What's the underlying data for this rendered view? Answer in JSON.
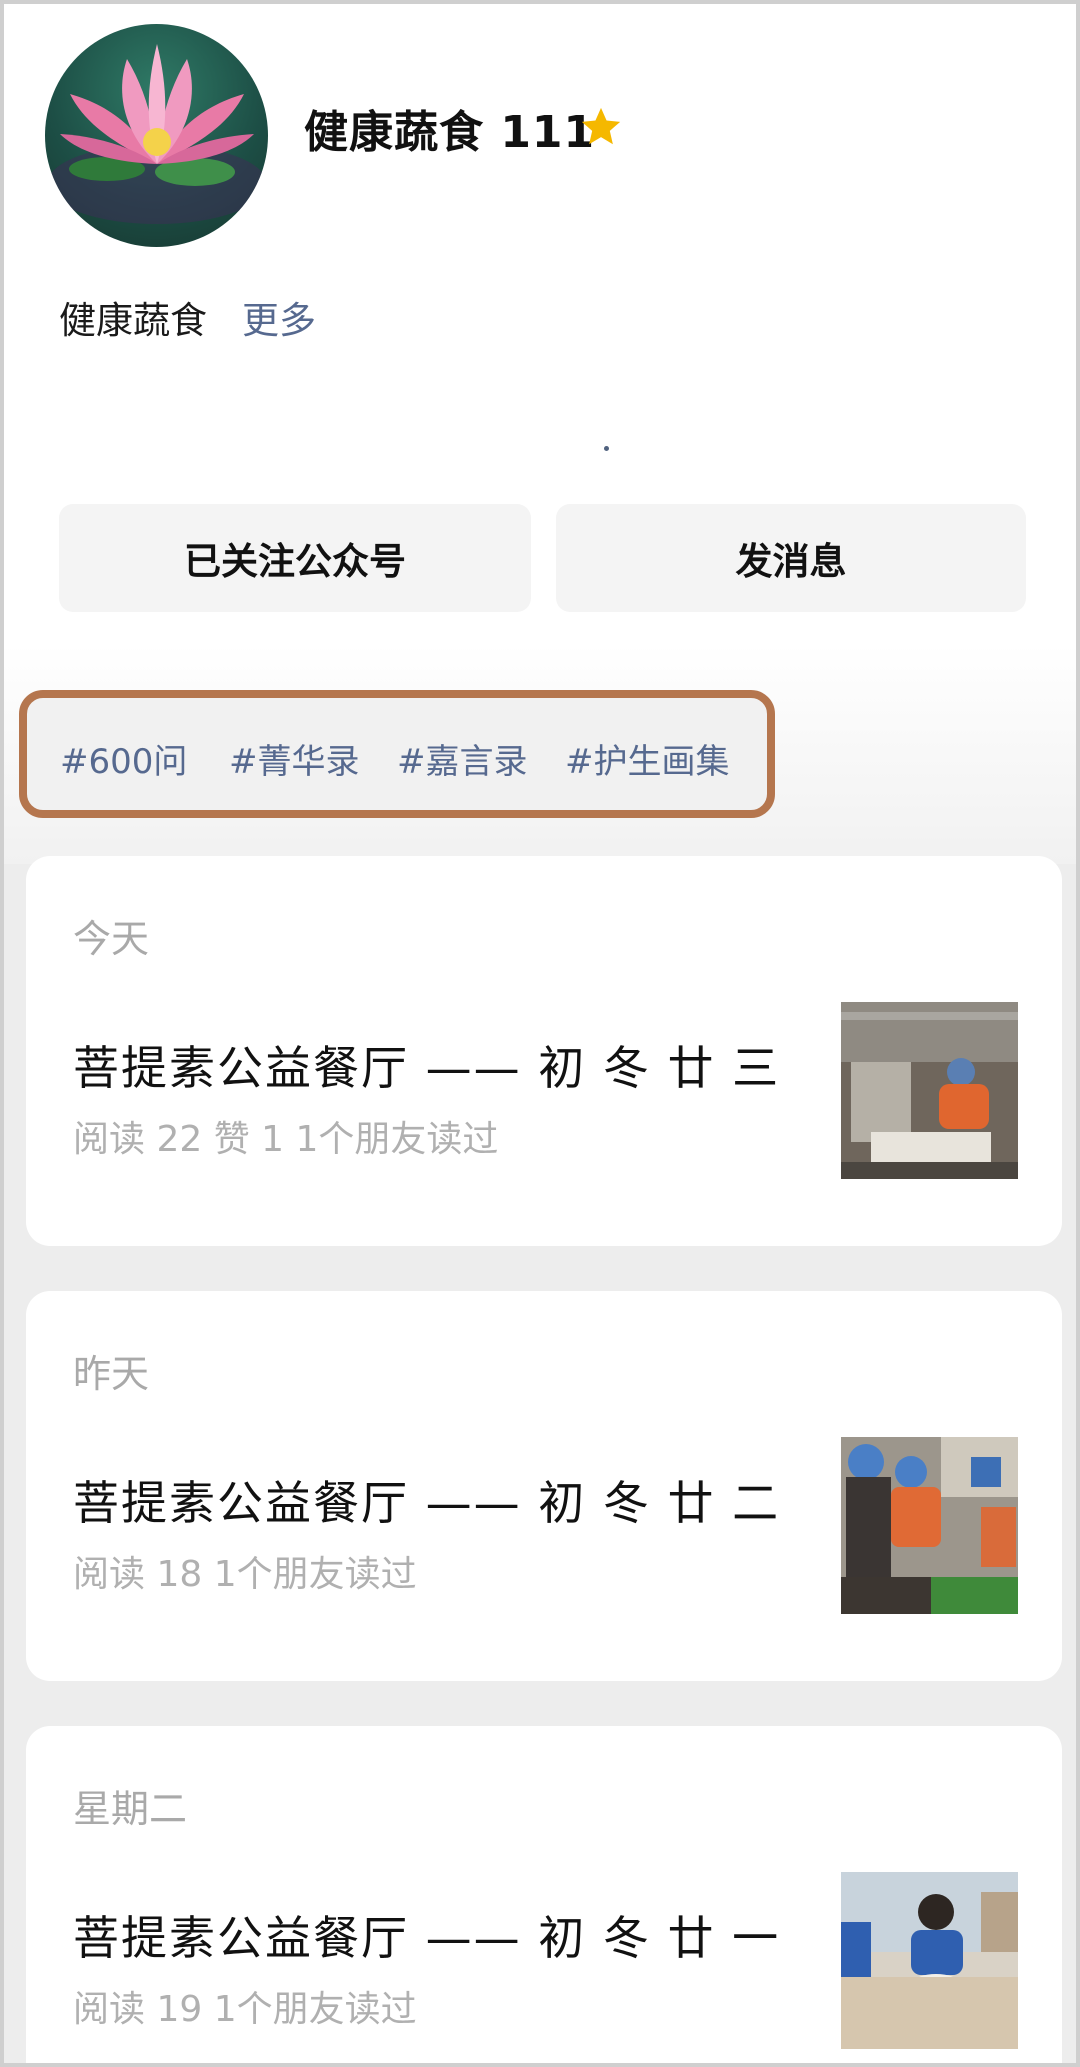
{
  "profile": {
    "name": "健康蔬食 111",
    "bio": "健康蔬食",
    "more_label": "更多",
    "star_icon": "star-icon",
    "star_color": "#f5b800"
  },
  "actions": {
    "follow_label": "已关注公众号",
    "message_label": "发消息"
  },
  "tags": [
    "#600问",
    "#菁华录",
    "#嘉言录",
    "#护生画集"
  ],
  "tag_highlight_color": "#b5764e",
  "articles": [
    {
      "date": "今天",
      "title": "菩提素公益餐厅 —— 初 冬 廿 三",
      "meta": "阅读 22  赞 1  1个朋友读过"
    },
    {
      "date": "昨天",
      "title": "菩提素公益餐厅 —— 初 冬 廿 二",
      "meta": "阅读 18  1个朋友读过"
    },
    {
      "date": "星期二",
      "title": "菩提素公益餐厅 —— 初 冬 廿 一",
      "meta": "阅读 19  1个朋友读过"
    }
  ]
}
